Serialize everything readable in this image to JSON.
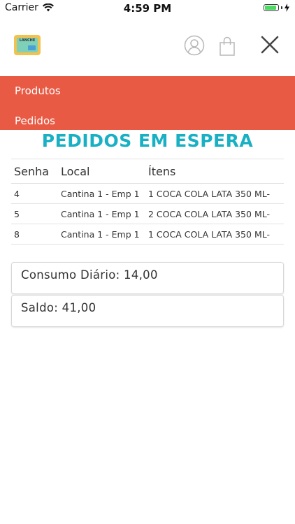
{
  "status_bar": {
    "carrier": "Carrier",
    "time": "4:59 PM",
    "icons": [
      "wifi-icon",
      "battery-icon",
      "charging-icon"
    ],
    "battery_level": 0.9,
    "battery_color": "#4cd964"
  },
  "header": {
    "logo_text": "LANCHE",
    "icons": [
      "user-icon",
      "shopping-bag-icon",
      "close-icon"
    ]
  },
  "menu": {
    "background": "#e85a44",
    "items": [
      {
        "label": "Produtos"
      },
      {
        "label": "Pedidos"
      }
    ]
  },
  "page": {
    "title": "PEDIDOS EM ESPERA",
    "title_color": "#1ab0c4"
  },
  "orders_table": {
    "headers": {
      "senha": "Senha",
      "local": "Local",
      "itens": "Ítens"
    },
    "rows": [
      {
        "senha": "4",
        "local": "Cantina 1 - Emp 1",
        "itens": "1 COCA COLA LATA 350 ML-"
      },
      {
        "senha": "5",
        "local": "Cantina 1 - Emp 1",
        "itens": "2 COCA COLA LATA 350 ML-"
      },
      {
        "senha": "8",
        "local": "Cantina 1 - Emp 1",
        "itens": "1 COCA COLA LATA 350 ML-"
      }
    ]
  },
  "summary": {
    "consumo_label": "Consumo Diário:",
    "consumo_value": "14,00",
    "saldo_label": "Saldo:",
    "saldo_value": "41,00"
  }
}
